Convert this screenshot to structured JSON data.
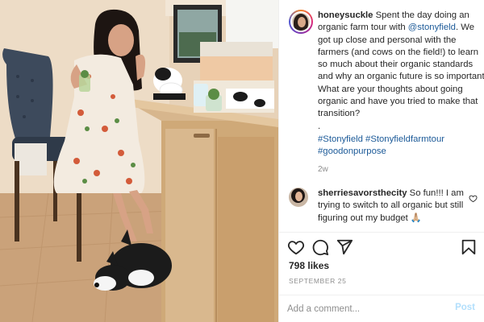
{
  "post": {
    "username": "honeysuckle",
    "caption_before_mention": "Spent the day doing an organic farm tour with",
    "mention": "@stonyfield",
    "caption_after_mention": ". We got up close and personal with the farmers (and cows on the field!) to learn so much about their organic standards and why an organic future is so important. What are your thoughts about going organic and have you tried to make that transition?",
    "caption_dot": ".",
    "hashtags": [
      "#Stonyfield",
      "#Stonyfieldfarmtour",
      "#goodonpurpose"
    ],
    "time_ago": "2w",
    "likes": "798 likes",
    "date": "SEPTEMBER 25"
  },
  "comments": [
    {
      "username": "sherriesavorsthecity",
      "text": "So fun!!! I am trying to switch to all organic but still figuring out my budget 🙏🏼"
    }
  ],
  "add_comment": {
    "placeholder": "Add a comment...",
    "post_label": "Post"
  },
  "icons": {
    "like": "heart-icon",
    "comment": "comment-icon",
    "share": "share-icon",
    "save": "bookmark-icon",
    "comment_like": "small-heart-icon"
  },
  "colors": {
    "link": "#1c5a98",
    "muted": "#8e8e8e",
    "post_button_disabled": "#b2dffc",
    "text": "#262626"
  }
}
